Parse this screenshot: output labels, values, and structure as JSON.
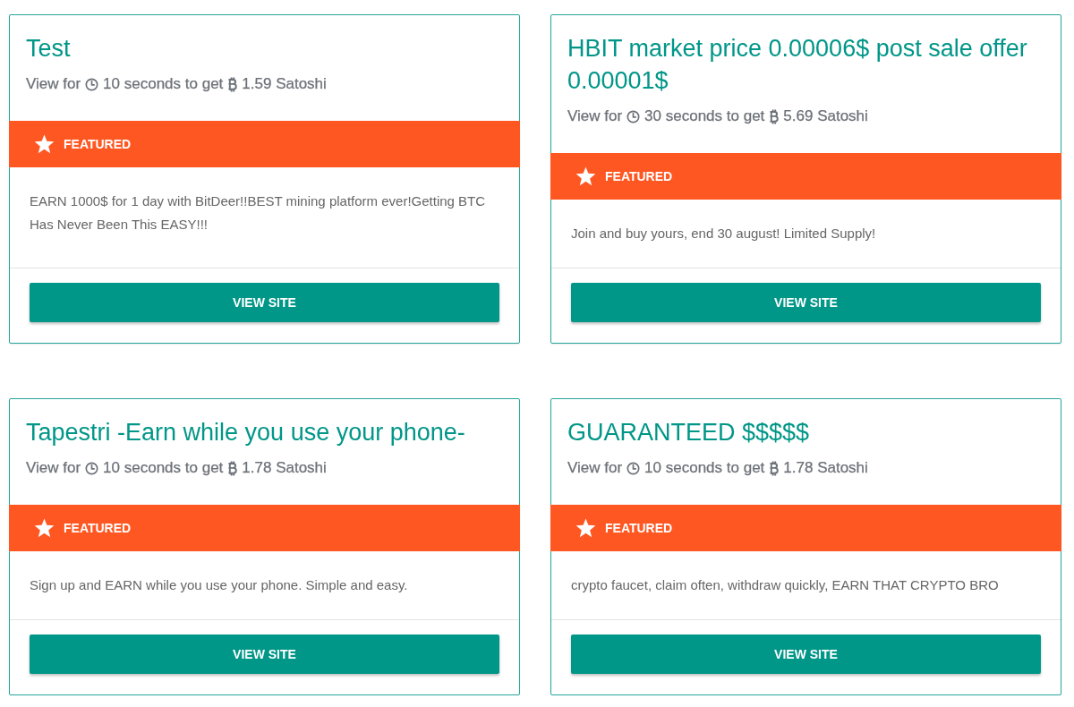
{
  "offers": [
    {
      "title": "Test",
      "lead": "View for",
      "timer_text": "10 seconds to get",
      "reward_text": "1.59 Satoshi",
      "badge": "FEATURED",
      "description": "EARN 1000$ for 1 day with BitDeer!!BEST mining platform ever!Getting BTC Has Never Been This EASY!!!",
      "button": "VIEW SITE"
    },
    {
      "title": "HBIT market price 0.00006$ post sale offer 0.00001$",
      "lead": "View for",
      "timer_text": "30 seconds to get",
      "reward_text": "5.69 Satoshi",
      "badge": "FEATURED",
      "description": "Join and buy yours, end 30 august! Limited Supply!",
      "button": "VIEW SITE"
    },
    {
      "title": "Tapestri -Earn while you use your phone-",
      "lead": "View for",
      "timer_text": "10 seconds to get",
      "reward_text": "1.78 Satoshi",
      "badge": "FEATURED",
      "description": "Sign up and EARN while you use your phone. Simple and easy.",
      "button": "VIEW SITE"
    },
    {
      "title": "GUARANTEED $$$$$",
      "lead": "View for",
      "timer_text": "10 seconds to get",
      "reward_text": "1.78 Satoshi",
      "badge": "FEATURED",
      "description": "crypto faucet, claim often, withdraw quickly, EARN THAT CRYPTO BRO",
      "button": "VIEW SITE"
    }
  ]
}
